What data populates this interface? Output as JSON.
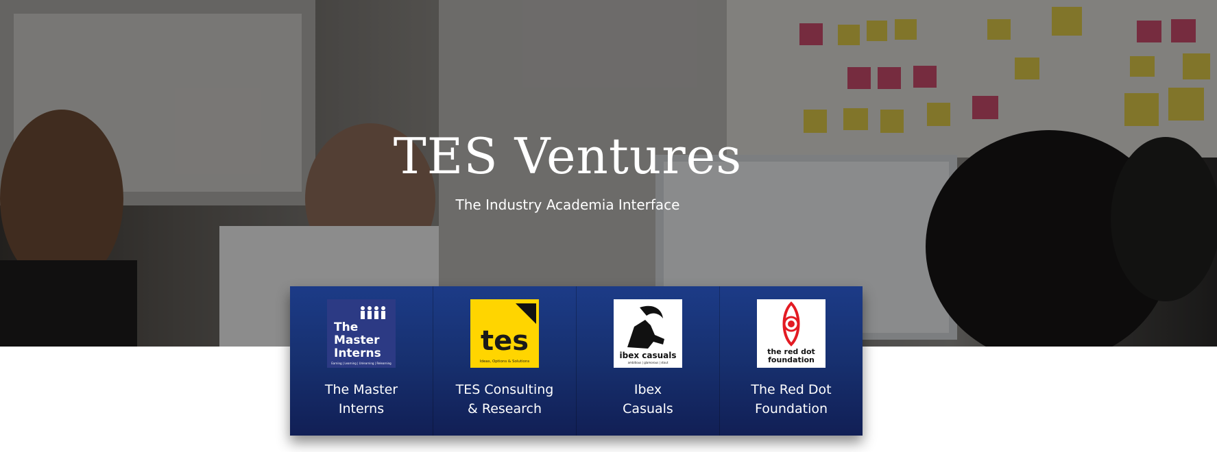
{
  "hero": {
    "title": "TES Ventures",
    "subtitle": "The Industry Academia Interface",
    "image": "office-meeting-photo"
  },
  "ventures": [
    {
      "label_lines": [
        "The Master",
        "Interns"
      ],
      "logo": {
        "icon": "master-interns-logo",
        "bg": "#2c3a84",
        "text_lines": [
          "The",
          "Master",
          "Interns"
        ],
        "tagline": "Earning | Learning | Unlearning | Relearning"
      }
    },
    {
      "label_lines": [
        "TES Consulting",
        "& Research"
      ],
      "logo": {
        "icon": "tes-logo",
        "bg": "#ffd500",
        "text": "tes",
        "tagline": "Ideas, Options & Solutions"
      }
    },
    {
      "label_lines": [
        "Ibex",
        "Casuals"
      ],
      "logo": {
        "icon": "ibex-casuals-logo",
        "bg": "#ffffff",
        "text": "ibex casuals",
        "tagline": "ambitious | glamorous | stout"
      }
    },
    {
      "label_lines": [
        "The Red Dot",
        "Foundation"
      ],
      "logo": {
        "icon": "red-dot-foundation-logo",
        "bg": "#ffffff",
        "accent": "#e31b23",
        "text_lines": [
          "the red dot",
          "foundation"
        ]
      }
    }
  ]
}
